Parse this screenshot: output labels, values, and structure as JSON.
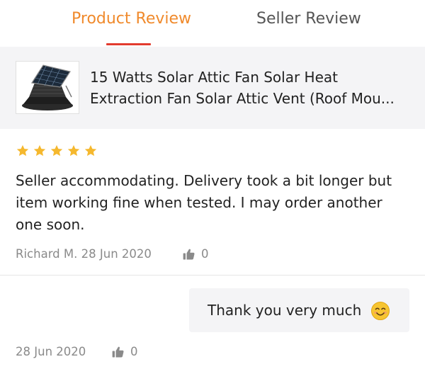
{
  "tabs": [
    {
      "label": "Product Review",
      "active": true
    },
    {
      "label": "Seller Review",
      "active": false
    }
  ],
  "colors": {
    "active_tab": "#f08a2c",
    "underline": "#e23b2e",
    "star": "#f5b82e",
    "card_bg": "#f4f4f6"
  },
  "product": {
    "title": "15 Watts Solar Attic Fan Solar Heat Extraction Fan Solar Attic Vent (Roof Mou...",
    "thumbnail_icon": "solar-attic-fan-image"
  },
  "review": {
    "rating": 5,
    "max_rating": 5,
    "text": "Seller accommodating. Delivery took a bit longer but item working fine when tested. I may order another one soon.",
    "author_date": "Richard M. 28 Jun 2020",
    "likes": "0",
    "like_icon": "thumbs-up-icon"
  },
  "reply": {
    "text": "Thank you very much",
    "emoji": "smiling-face-emoji",
    "date": "28 Jun 2020",
    "likes": "0",
    "like_icon": "thumbs-up-icon"
  }
}
